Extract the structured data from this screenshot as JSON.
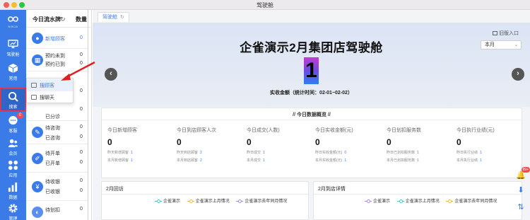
{
  "window": {
    "title": "驾驶舱"
  },
  "colors": {
    "nav_bg": "#3b7be8",
    "accent": "#3b7be8",
    "alert": "#f24c4c",
    "highlight_border": "#e1344f"
  },
  "nav": {
    "logo_text": "NINJA",
    "items": [
      {
        "label": "驾驶舱",
        "icon": "monitor-icon"
      },
      {
        "label": "常用",
        "icon": "cube-icon"
      },
      {
        "label": "搜索",
        "icon": "search-icon",
        "active": true
      },
      {
        "label": "客服",
        "icon": "chat-icon",
        "badge": "0"
      },
      {
        "label": "会员",
        "icon": "members-icon"
      },
      {
        "label": "应用",
        "icon": "apps-icon"
      },
      {
        "label": "数据",
        "icon": "bar-chart-icon"
      },
      {
        "label": "管理",
        "icon": "gear-icon"
      }
    ]
  },
  "panel": {
    "title": "今日流水牌",
    "qty_header": "数量",
    "rows": [
      {
        "labels": [
          "新增顾客"
        ],
        "num": "0",
        "blue": true
      },
      {
        "labels": [
          "预约未到",
          "预约已到"
        ],
        "num": "0",
        "blue": false
      },
      {
        "labels": [
          "",
          "已分诊"
        ],
        "num": "0",
        "blue": false
      },
      {
        "labels": [
          "待咨询",
          "已咨询"
        ],
        "num": "0",
        "blue": false
      },
      {
        "labels": [
          "待开单",
          "已开单"
        ],
        "num": "0",
        "blue": false
      },
      {
        "labels": [
          "待收银",
          "已收银"
        ],
        "num": "0",
        "blue": false
      },
      {
        "labels": [
          "待划扣"
        ],
        "num": "0",
        "blue": false
      }
    ],
    "row_nums_second": [
      "0",
      "0",
      "0",
      "0",
      "0",
      "0",
      "0"
    ]
  },
  "popup": {
    "items": [
      {
        "label": "搜顾客",
        "active": true
      },
      {
        "label": "搜聊天",
        "active": false
      }
    ]
  },
  "tabs": [
    {
      "label": "驾驶舱"
    }
  ],
  "hero": {
    "old_entry": "旧版入口",
    "month_select": "本月",
    "title": "企雀演示2月集团店驾驶舱",
    "big_number": "1",
    "amount_label": "实收金额（统计时间：02-01~02-02）"
  },
  "stats": {
    "header": "// 今日数据概览 //",
    "items": [
      {
        "label": "今日新增顾客",
        "value": "0",
        "sub1": "昨天新增顾客",
        "sub1_val": "1",
        "sub2": "本月新增顾客",
        "sub2_val": "1"
      },
      {
        "label": "今日到店顾客人次",
        "value": "0",
        "sub1": "昨天到店顾客",
        "sub1_val": "2",
        "sub2": "本月到店顾客",
        "sub2_val": "2"
      },
      {
        "label": "今日成交(人数)",
        "value": "0",
        "sub1": "昨日成交",
        "sub1_val": "1",
        "sub2": "本月成交",
        "sub2_val": "1"
      },
      {
        "label": "今日实收金额(元)",
        "value": "0",
        "sub1": "昨日实收金额(元)",
        "sub1_val": "0",
        "sub2": "本月实收金额(元)",
        "sub2_val": "1"
      },
      {
        "label": "今日划扣服务数",
        "value": "0",
        "sub1": "昨日已划扣服务数",
        "sub1_val": "1",
        "sub2": "本月已划扣服务数",
        "sub2_val": "1"
      },
      {
        "label": "今日执行业绩(元)",
        "value": "0",
        "sub1": "昨日执行业绩",
        "sub1_val": "1",
        "sub2": "本月执行业绩",
        "sub2_val": "1"
      }
    ]
  },
  "bottom": {
    "left": {
      "title": "2月回访",
      "legend": [
        "企雀演示",
        "企雀演示上月情况",
        "企雀演示去年同月情况"
      ]
    },
    "right": {
      "title": "2月到店详情",
      "legend": [
        "企雀演示",
        "企雀演示上月情况",
        "企雀演示去年同月情况"
      ]
    },
    "legend_colors": [
      "#4fc3c0",
      "#f0b84b",
      "#a78bd8"
    ]
  },
  "floating": {
    "badge": "99+"
  }
}
